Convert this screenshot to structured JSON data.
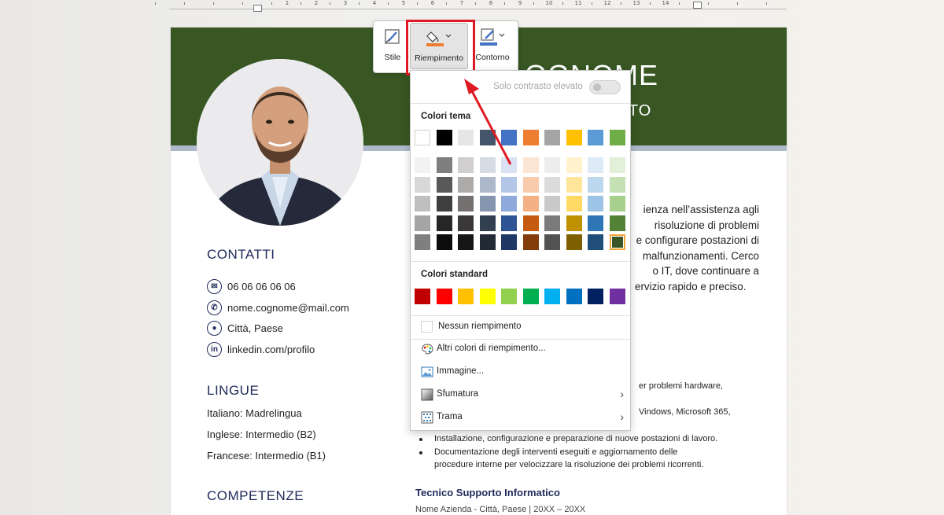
{
  "ruler": {
    "numbers": [
      "1",
      "2",
      "3",
      "4",
      "5",
      "6",
      "7",
      "8",
      "9",
      "10",
      "11",
      "12",
      "13",
      "14"
    ]
  },
  "resume": {
    "name_fragment": "OGNOME",
    "role_fragment": "ATO",
    "contacts_title": "CONTATTI",
    "contacts": [
      {
        "icon": "mail-icon",
        "text": "06 06 06 06 06"
      },
      {
        "icon": "phone-icon",
        "text": "nome.cognome@mail.com"
      },
      {
        "icon": "location-pin-icon",
        "text": "Città, Paese"
      },
      {
        "icon": "linkedin-icon",
        "text": "linkedin.com/profilo"
      }
    ],
    "languages_title": "LINGUE",
    "languages": [
      "Italiano: Madrelingua",
      "Inglese: Intermedio (B2)",
      "Francese: Intermedio (B1)"
    ],
    "skills_title": "COMPETENZE",
    "summary_lines": [
      "ienza nell’assistenza agli",
      "risoluzione di problemi",
      "e configurare postazioni di",
      "malfunzionamenti. Cerco",
      "o IT, dove continuare a",
      "ervizio rapido e preciso."
    ],
    "partial_lines": [
      "er problemi hardware,",
      "Vindows, Microsoft 365,"
    ],
    "bullets": [
      "Installazione, configurazione e preparazione di nuove postazioni di lavoro.",
      "Documentazione degli interventi eseguiti e aggiornamento delle",
      "procedure interne per velocizzare la risoluzione dei problemi ricorrenti."
    ],
    "job_title": "Tecnico Supporto Informatico",
    "job_sub": "Nome Azienda - Città, Paese | 20XX – 20XX"
  },
  "toolbar": {
    "style_label": "Stile",
    "fill_label": "Riempimento",
    "outline_label": "Contorno",
    "fill_color": "#ed7d31",
    "outline_color": "#4472c4"
  },
  "fill_menu": {
    "high_contrast_label": "Solo contrasto elevato",
    "high_contrast_on": false,
    "theme_colors_title": "Colori tema",
    "theme_colors": [
      "#ffffff",
      "#000000",
      "#e7e6e6",
      "#44546a",
      "#4472c4",
      "#ed7d31",
      "#a5a5a5",
      "#ffc000",
      "#5b9bd5",
      "#70ad47"
    ],
    "theme_shades": [
      [
        "#f2f2f2",
        "#7f7f7f",
        "#d0cece",
        "#d6dce4",
        "#d9e2f3",
        "#fbe5d5",
        "#ededed",
        "#fff2cc",
        "#deebf6",
        "#e2efd9"
      ],
      [
        "#d8d8d8",
        "#595959",
        "#aeabab",
        "#adb9ca",
        "#b4c6e7",
        "#f7cbac",
        "#dbdbdb",
        "#fee599",
        "#bdd7ee",
        "#c5e0b3"
      ],
      [
        "#bfbfbf",
        "#3f3f3f",
        "#757070",
        "#8496b0",
        "#8eaadb",
        "#f4b183",
        "#c9c9c9",
        "#ffd965",
        "#9dc3e6",
        "#a8d08d"
      ],
      [
        "#a5a5a5",
        "#262626",
        "#3a3838",
        "#323f4f",
        "#2f5496",
        "#c55a11",
        "#7b7b7b",
        "#bf9000",
        "#2e75b5",
        "#538135"
      ],
      [
        "#7f7f7f",
        "#0c0c0c",
        "#171616",
        "#222a35",
        "#1f3864",
        "#833c0b",
        "#525252",
        "#7f6000",
        "#1e4e79",
        "#375623"
      ]
    ],
    "standard_colors_title": "Colori standard",
    "standard_colors": [
      "#c00000",
      "#ff0000",
      "#ffc000",
      "#ffff00",
      "#92d050",
      "#00b050",
      "#00b0f0",
      "#0070c0",
      "#002060",
      "#7030a0"
    ],
    "no_fill_label": "Nessun riempimento",
    "more_colors_label": "Altri colori di riempimento...",
    "picture_label": "Immagine...",
    "gradient_label": "Sfumatura",
    "texture_label": "Trama"
  }
}
